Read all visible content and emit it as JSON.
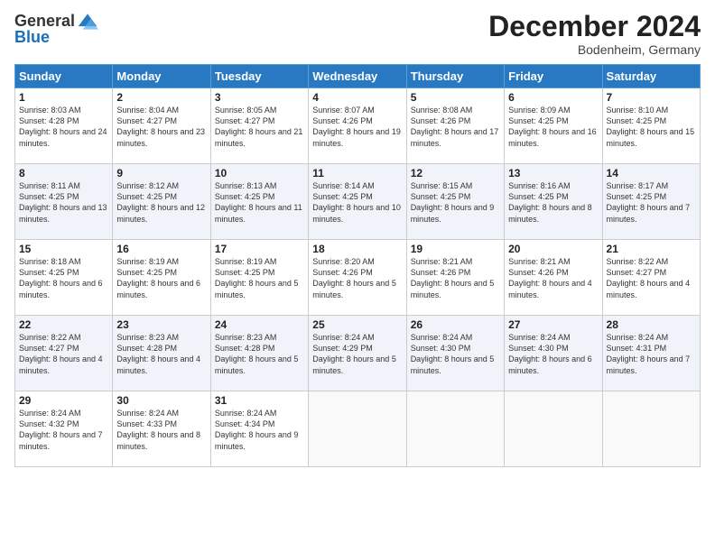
{
  "header": {
    "logo_general": "General",
    "logo_blue": "Blue",
    "month_title": "December 2024",
    "subtitle": "Bodenheim, Germany"
  },
  "days_of_week": [
    "Sunday",
    "Monday",
    "Tuesday",
    "Wednesday",
    "Thursday",
    "Friday",
    "Saturday"
  ],
  "weeks": [
    [
      {
        "day": "1",
        "info": "Sunrise: 8:03 AM\nSunset: 4:28 PM\nDaylight: 8 hours and 24 minutes."
      },
      {
        "day": "2",
        "info": "Sunrise: 8:04 AM\nSunset: 4:27 PM\nDaylight: 8 hours and 23 minutes."
      },
      {
        "day": "3",
        "info": "Sunrise: 8:05 AM\nSunset: 4:27 PM\nDaylight: 8 hours and 21 minutes."
      },
      {
        "day": "4",
        "info": "Sunrise: 8:07 AM\nSunset: 4:26 PM\nDaylight: 8 hours and 19 minutes."
      },
      {
        "day": "5",
        "info": "Sunrise: 8:08 AM\nSunset: 4:26 PM\nDaylight: 8 hours and 17 minutes."
      },
      {
        "day": "6",
        "info": "Sunrise: 8:09 AM\nSunset: 4:25 PM\nDaylight: 8 hours and 16 minutes."
      },
      {
        "day": "7",
        "info": "Sunrise: 8:10 AM\nSunset: 4:25 PM\nDaylight: 8 hours and 15 minutes."
      }
    ],
    [
      {
        "day": "8",
        "info": "Sunrise: 8:11 AM\nSunset: 4:25 PM\nDaylight: 8 hours and 13 minutes."
      },
      {
        "day": "9",
        "info": "Sunrise: 8:12 AM\nSunset: 4:25 PM\nDaylight: 8 hours and 12 minutes."
      },
      {
        "day": "10",
        "info": "Sunrise: 8:13 AM\nSunset: 4:25 PM\nDaylight: 8 hours and 11 minutes."
      },
      {
        "day": "11",
        "info": "Sunrise: 8:14 AM\nSunset: 4:25 PM\nDaylight: 8 hours and 10 minutes."
      },
      {
        "day": "12",
        "info": "Sunrise: 8:15 AM\nSunset: 4:25 PM\nDaylight: 8 hours and 9 minutes."
      },
      {
        "day": "13",
        "info": "Sunrise: 8:16 AM\nSunset: 4:25 PM\nDaylight: 8 hours and 8 minutes."
      },
      {
        "day": "14",
        "info": "Sunrise: 8:17 AM\nSunset: 4:25 PM\nDaylight: 8 hours and 7 minutes."
      }
    ],
    [
      {
        "day": "15",
        "info": "Sunrise: 8:18 AM\nSunset: 4:25 PM\nDaylight: 8 hours and 6 minutes."
      },
      {
        "day": "16",
        "info": "Sunrise: 8:19 AM\nSunset: 4:25 PM\nDaylight: 8 hours and 6 minutes."
      },
      {
        "day": "17",
        "info": "Sunrise: 8:19 AM\nSunset: 4:25 PM\nDaylight: 8 hours and 5 minutes."
      },
      {
        "day": "18",
        "info": "Sunrise: 8:20 AM\nSunset: 4:26 PM\nDaylight: 8 hours and 5 minutes."
      },
      {
        "day": "19",
        "info": "Sunrise: 8:21 AM\nSunset: 4:26 PM\nDaylight: 8 hours and 5 minutes."
      },
      {
        "day": "20",
        "info": "Sunrise: 8:21 AM\nSunset: 4:26 PM\nDaylight: 8 hours and 4 minutes."
      },
      {
        "day": "21",
        "info": "Sunrise: 8:22 AM\nSunset: 4:27 PM\nDaylight: 8 hours and 4 minutes."
      }
    ],
    [
      {
        "day": "22",
        "info": "Sunrise: 8:22 AM\nSunset: 4:27 PM\nDaylight: 8 hours and 4 minutes."
      },
      {
        "day": "23",
        "info": "Sunrise: 8:23 AM\nSunset: 4:28 PM\nDaylight: 8 hours and 4 minutes."
      },
      {
        "day": "24",
        "info": "Sunrise: 8:23 AM\nSunset: 4:28 PM\nDaylight: 8 hours and 5 minutes."
      },
      {
        "day": "25",
        "info": "Sunrise: 8:24 AM\nSunset: 4:29 PM\nDaylight: 8 hours and 5 minutes."
      },
      {
        "day": "26",
        "info": "Sunrise: 8:24 AM\nSunset: 4:30 PM\nDaylight: 8 hours and 5 minutes."
      },
      {
        "day": "27",
        "info": "Sunrise: 8:24 AM\nSunset: 4:30 PM\nDaylight: 8 hours and 6 minutes."
      },
      {
        "day": "28",
        "info": "Sunrise: 8:24 AM\nSunset: 4:31 PM\nDaylight: 8 hours and 7 minutes."
      }
    ],
    [
      {
        "day": "29",
        "info": "Sunrise: 8:24 AM\nSunset: 4:32 PM\nDaylight: 8 hours and 7 minutes."
      },
      {
        "day": "30",
        "info": "Sunrise: 8:24 AM\nSunset: 4:33 PM\nDaylight: 8 hours and 8 minutes."
      },
      {
        "day": "31",
        "info": "Sunrise: 8:24 AM\nSunset: 4:34 PM\nDaylight: 8 hours and 9 minutes."
      },
      null,
      null,
      null,
      null
    ]
  ]
}
